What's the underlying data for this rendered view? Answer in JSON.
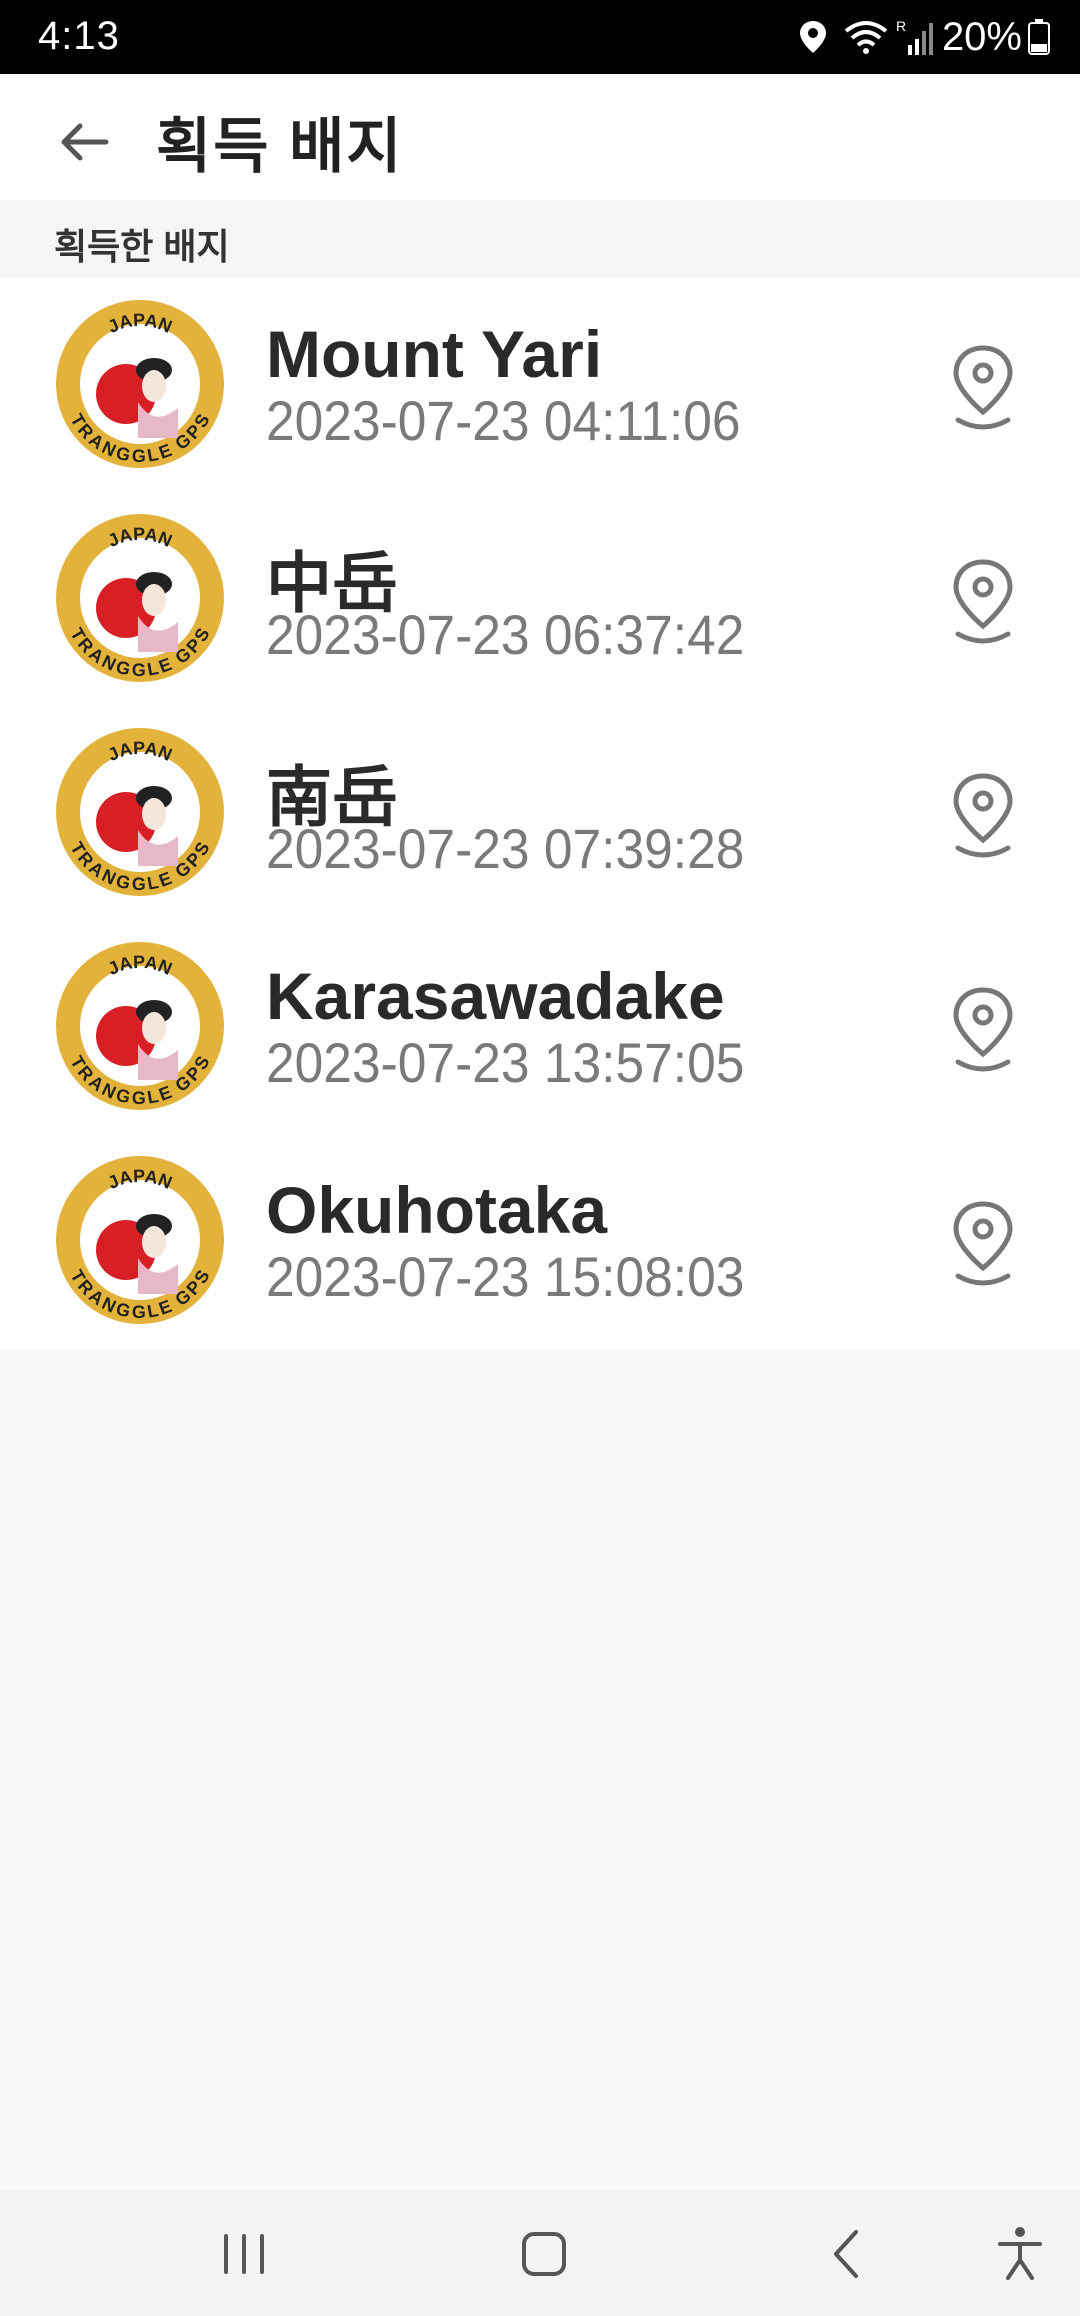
{
  "status_bar": {
    "time": "4:13",
    "battery_text": "20%",
    "icons": [
      "location-icon",
      "wifi-icon",
      "signal-icon",
      "battery-icon"
    ]
  },
  "header": {
    "title": "획득 배지",
    "back_icon": "arrow-left-icon"
  },
  "section": {
    "title": "획득한 배지"
  },
  "badges": [
    {
      "name": "Mount Yari",
      "time": "2023-07-23 04:11:06"
    },
    {
      "name": "中岳",
      "time": "2023-07-23 06:37:42"
    },
    {
      "name": "南岳",
      "time": "2023-07-23 07:39:28"
    },
    {
      "name": "Karasawadake",
      "time": "2023-07-23 13:57:05"
    },
    {
      "name": "Okuhotaka",
      "time": "2023-07-23 15:08:03"
    }
  ],
  "badge_emblem": {
    "top_text": "JAPAN",
    "bottom_text": "TRANGGLE GPS"
  },
  "nav_bar": {
    "icons": [
      "recent-apps-icon",
      "home-icon",
      "back-icon",
      "accessibility-icon"
    ]
  },
  "colors": {
    "status_bar": "#000000",
    "header_bg": "#ffffff",
    "section_bg": "#f5f5f5",
    "page_bg": "#f9f9f9",
    "title_text": "#222222",
    "time_text": "#7a7a7a",
    "badge_gold": "#e2b23a",
    "badge_red": "#d81f26"
  }
}
